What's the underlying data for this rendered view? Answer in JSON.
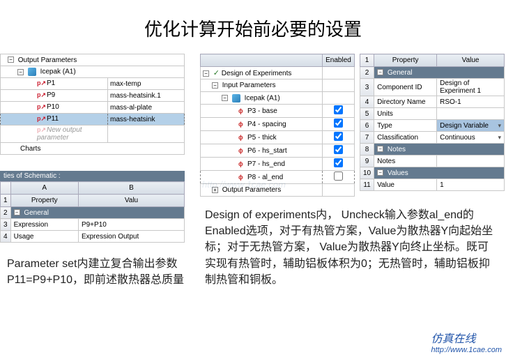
{
  "title": "优化计算开始前必要的设置",
  "output_params": {
    "header_label": "Output Parameters",
    "icepak_label": "Icepak (A1)",
    "rows": [
      {
        "name": "P1",
        "value": "max-temp"
      },
      {
        "name": "P9",
        "value": "mass-heatsink.1"
      },
      {
        "name": "P10",
        "value": "mass-al-plate"
      },
      {
        "name": "P11",
        "value": "mass-heatsink"
      }
    ],
    "new_param_label": "New output parameter",
    "charts_label": "Charts"
  },
  "doe": {
    "col_enabled": "Enabled",
    "root_label": "Design of Experiments",
    "input_label": "Input Parameters",
    "icepak_label": "Icepak (A1)",
    "params": [
      {
        "name": "P3 - base",
        "enabled": true
      },
      {
        "name": "P4 - spacing",
        "enabled": true
      },
      {
        "name": "P5 - thick",
        "enabled": true
      },
      {
        "name": "P6 - hs_start",
        "enabled": true
      },
      {
        "name": "P7 - hs_end",
        "enabled": true
      },
      {
        "name": "P8 - al_end",
        "enabled": false
      }
    ],
    "output_label": "Output Parameters"
  },
  "props": {
    "col1": "1",
    "col_prop": "Property",
    "col_val": "Value",
    "rows": [
      {
        "n": "2",
        "section": "General"
      },
      {
        "n": "3",
        "prop": "Component ID",
        "val": "Design of Experiment 1"
      },
      {
        "n": "4",
        "prop": "Directory Name",
        "val": "RSO-1"
      },
      {
        "n": "5",
        "prop": "Units",
        "val": ""
      },
      {
        "n": "6",
        "prop": "Type",
        "val": "Design Variable",
        "hl": true
      },
      {
        "n": "7",
        "prop": "Classification",
        "val": "Continuous"
      },
      {
        "n": "8",
        "section": "Notes"
      },
      {
        "n": "9",
        "prop": "Notes",
        "val": ""
      },
      {
        "n": "10",
        "section": "Values"
      },
      {
        "n": "11",
        "prop": "Value",
        "val": "1"
      }
    ]
  },
  "schematic": {
    "title": "ties of Schematic :",
    "col_a": "A",
    "col_b": "B",
    "col_prop": "Property",
    "col_val": "Valu",
    "section": "General",
    "rows": [
      {
        "prop": "Expression",
        "val": "P9+P10"
      },
      {
        "prop": "Usage",
        "val": "Expression Output"
      }
    ]
  },
  "desc_left": "Parameter set内建立复合输出参数 P11=P9+P10，即前述散热器总质量",
  "desc_right": "Design of experiments内， Uncheck输入参数al_end的Enabled选项，对于有热管方案，Value为散热器Y向起始坐标；对于无热管方案， Value为散热器Y向终止坐标。既可实现有热管时，辅助铝板体积为0；无热管时，辅助铝板抑制热管和铜板。",
  "watermark": {
    "cn": "仿真在线",
    "url": "http://www.1cae.com"
  },
  "glyph": {
    "minus": "−",
    "plus": "+",
    "check": "✓",
    "drop": "▾",
    "param": "p↗",
    "dp": "ɸ"
  }
}
